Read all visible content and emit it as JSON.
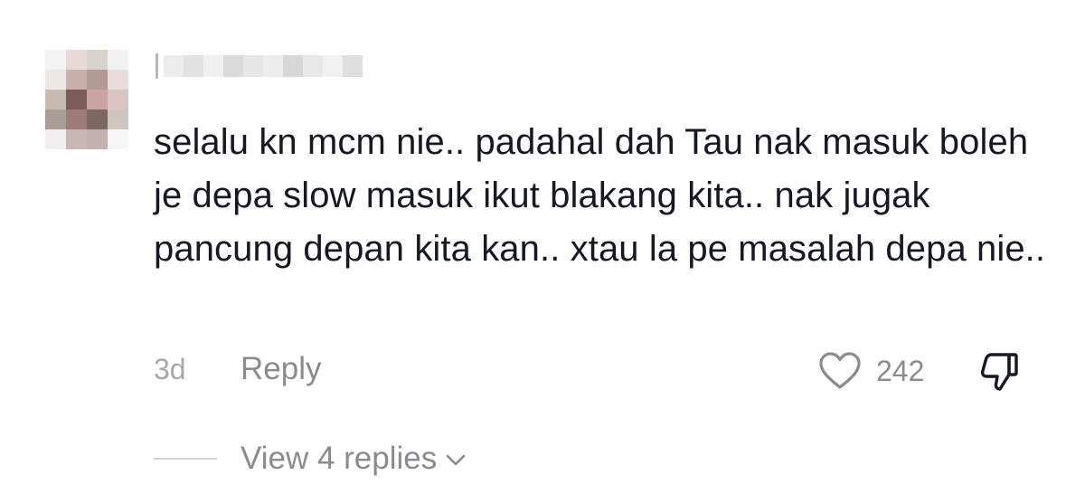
{
  "comment": {
    "avatar": {
      "icon": "avatar-blurred",
      "pixels": [
        "#f3f3f3",
        "#e8d9d9",
        "#d8d3cd",
        "#f2f2f2",
        "#ece8e6",
        "#c9b0ab",
        "#b29a95",
        "#e9dcdc",
        "#c7bab0",
        "#7a5c59",
        "#caa5a1",
        "#d9c6c4",
        "#a99e97",
        "#9c7b78",
        "#7d6763",
        "#d0c6c0",
        "#f0eeee",
        "#c9b7b5",
        "#c4b2b0",
        "#f6f6f6"
      ]
    },
    "username_blur_colors": [
      "#ececec",
      "#e2e2e2",
      "#f0f0f0",
      "#dadada",
      "#e6e6e6",
      "#ededed",
      "#d7d7d7",
      "#e8e8e8",
      "#f1f1f1",
      "#dedede"
    ],
    "text": "selalu kn mcm nie.. padahal dah Tau nak masuk boleh je depa slow masuk ikut blakang kita.. nak jugak pancung depan kita kan.. xtau la pe masalah depa nie..",
    "timestamp": "3d",
    "reply_label": "Reply",
    "like_count": "242",
    "view_replies_label": "View 4 replies",
    "icons": {
      "like": "heart-outline-icon",
      "dislike": "thumbs-down-icon",
      "expand": "chevron-down-icon"
    },
    "colors": {
      "text": "#161823",
      "secondary": "#8a8b91",
      "timestamp": "#a6a7ab"
    }
  }
}
